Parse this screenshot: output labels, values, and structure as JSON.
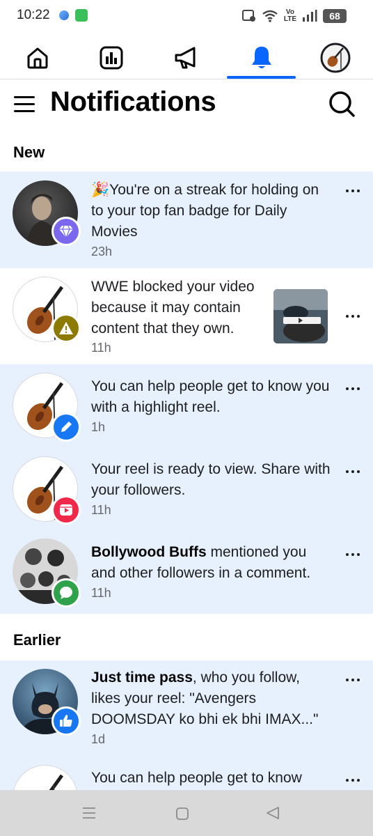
{
  "status_bar": {
    "time": "10:22",
    "battery": "68",
    "volte_line1": "Vo",
    "volte_line2": "LTE"
  },
  "tabs": [
    {
      "name": "home",
      "icon": "home-icon"
    },
    {
      "name": "dashboard",
      "icon": "bar-chart-icon"
    },
    {
      "name": "ads",
      "icon": "megaphone-icon"
    },
    {
      "name": "notifications",
      "icon": "bell-icon",
      "active": true
    },
    {
      "name": "profile",
      "icon": "violin-avatar-icon"
    }
  ],
  "header": {
    "title": "Notifications"
  },
  "sections": {
    "new": "New",
    "earlier": "Earlier"
  },
  "notifications": [
    {
      "text": "🎉You're on a streak for holding on to your top fan badge for Daily Movies",
      "time": "23h",
      "badge_icon": "diamond-icon",
      "badge_color": "#7b68ee",
      "unread": true
    },
    {
      "text": "WWE blocked your video because it may contain content that they own.",
      "time": "11h",
      "badge_icon": "warning-icon",
      "badge_color": "#8d7a00",
      "unread": false
    },
    {
      "text": "You can help people get to know you with a highlight reel.",
      "time": "1h",
      "badge_icon": "pencil-icon",
      "badge_color": "#1877f2",
      "unread": true
    },
    {
      "text": "Your reel is ready to view. Share with your followers.",
      "time": "11h",
      "badge_icon": "reel-icon",
      "badge_color": "#f02849",
      "unread": true
    },
    {
      "bold": "Bollywood Buffs",
      "text": " mentioned you and other followers in a comment.",
      "time": "11h",
      "badge_icon": "comment-icon",
      "badge_color": "#31a24c",
      "unread": true
    },
    {
      "bold": "Just time pass",
      "text": ", who you follow, likes your reel: \"Avengers DOOMSDAY ko bhi ek bhi IMAX...\"",
      "time": "1d",
      "badge_icon": "like-icon",
      "badge_color": "#1877f2",
      "unread": true
    },
    {
      "text": "You can help people get to know",
      "unread": true
    }
  ],
  "colors": {
    "accent": "#0866ff",
    "unread_bg": "#e7f0fd"
  }
}
